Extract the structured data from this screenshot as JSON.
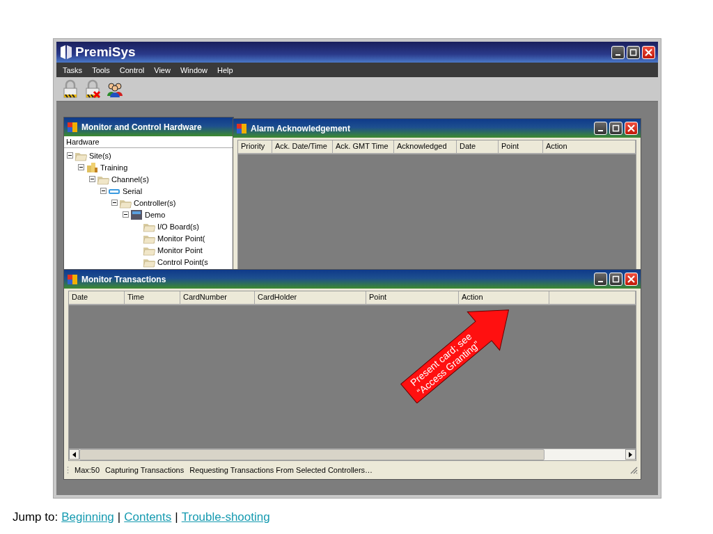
{
  "app": {
    "logo": "PremiSys"
  },
  "menu": [
    {
      "label": "Tasks"
    },
    {
      "label": "Tools"
    },
    {
      "label": "Control"
    },
    {
      "label": "View"
    },
    {
      "label": "Window"
    },
    {
      "label": "Help"
    }
  ],
  "hardware_window": {
    "title": "Monitor and Control Hardware",
    "header": "Hardware",
    "tree": [
      {
        "label": "Site(s)",
        "kind": "folder",
        "expanded": true,
        "children": [
          {
            "label": "Training",
            "kind": "site",
            "expanded": true,
            "children": [
              {
                "label": "Channel(s)",
                "kind": "folder",
                "expanded": true,
                "children": [
                  {
                    "label": "Serial",
                    "kind": "channel",
                    "expanded": true,
                    "children": [
                      {
                        "label": "Controller(s)",
                        "kind": "folder",
                        "expanded": true,
                        "children": [
                          {
                            "label": "Demo",
                            "kind": "controller",
                            "expanded": true,
                            "children": [
                              {
                                "label": "I/O Board(s)",
                                "kind": "folder"
                              },
                              {
                                "label": "Monitor Point(",
                                "kind": "folder"
                              },
                              {
                                "label": "Monitor Point",
                                "kind": "folder"
                              },
                              {
                                "label": "Control Point(s",
                                "kind": "folder"
                              }
                            ]
                          }
                        ]
                      }
                    ]
                  }
                ]
              }
            ]
          }
        ]
      }
    ]
  },
  "alarm_window": {
    "title": "Alarm Acknowledgement",
    "columns": [
      "Priority",
      "Ack. Date/Time",
      "Ack. GMT Time",
      "Acknowledged",
      "Date",
      "Point",
      "Action"
    ]
  },
  "transactions_window": {
    "title": "Monitor Transactions",
    "columns": [
      "Date",
      "Time",
      "CardNumber",
      "CardHolder",
      "Point",
      "Action"
    ],
    "status": [
      "Max:50",
      "Capturing Transactions",
      "Requesting Transactions From Selected Controllers…"
    ]
  },
  "callout": {
    "lines": [
      "Present card; see",
      "“Access Granting”"
    ]
  },
  "footer": {
    "label": "Jump to:",
    "separator": "|",
    "links": [
      "Beginning",
      "Contents",
      "Trouble-shooting"
    ]
  }
}
